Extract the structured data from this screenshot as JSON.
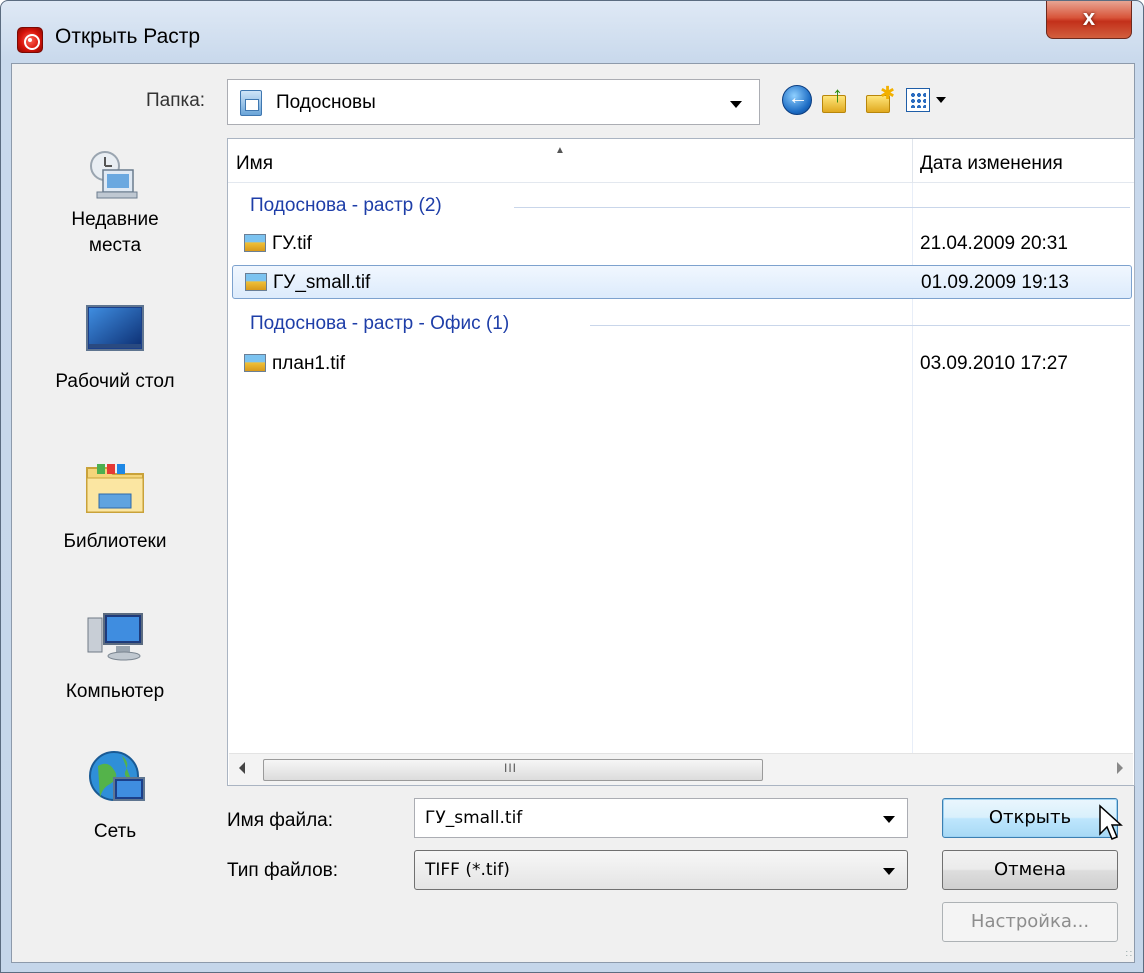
{
  "window": {
    "title": "Открыть Растр",
    "close_label": "x"
  },
  "folder": {
    "label": "Папка:",
    "value": "Подосновы"
  },
  "toolbar": {
    "back_icon": "back-arrow-icon",
    "up_icon": "up-folder-icon",
    "new_folder_icon": "new-folder-icon",
    "view_icon": "view-menu-icon"
  },
  "places": [
    {
      "label_line1": "Недавние",
      "label_line2": "места",
      "icon": "recent-places-icon"
    },
    {
      "label_line1": "Рабочий стол",
      "label_line2": "",
      "icon": "desktop-icon"
    },
    {
      "label_line1": "Библиотеки",
      "label_line2": "",
      "icon": "libraries-icon"
    },
    {
      "label_line1": "Компьютер",
      "label_line2": "",
      "icon": "computer-icon"
    },
    {
      "label_line1": "Сеть",
      "label_line2": "",
      "icon": "network-icon"
    }
  ],
  "list": {
    "col_name": "Имя",
    "col_date": "Дата изменения",
    "groups": [
      {
        "title": "Подоснова - растр (2)",
        "files": [
          {
            "name": "ГУ.tif",
            "date": "21.04.2009 20:31",
            "selected": false
          },
          {
            "name": "ГУ_small.tif",
            "date": "01.09.2009 19:13",
            "selected": true
          }
        ]
      },
      {
        "title": "Подоснова - растр - Офис (1)",
        "files": [
          {
            "name": "план1.tif",
            "date": "03.09.2010 17:27",
            "selected": false
          }
        ]
      }
    ],
    "scroll_grip": "III"
  },
  "filename": {
    "label": "Имя файла:",
    "value": "ГУ_small.tif"
  },
  "filetype": {
    "label": "Тип файлов:",
    "value": "TIFF (*.tif)"
  },
  "buttons": {
    "open": "Открыть",
    "cancel": "Отмена",
    "settings": "Настройка..."
  },
  "colors": {
    "group_header": "#1e3ea8",
    "selection_border": "#7da2ce",
    "close_button": "#c3301a"
  }
}
